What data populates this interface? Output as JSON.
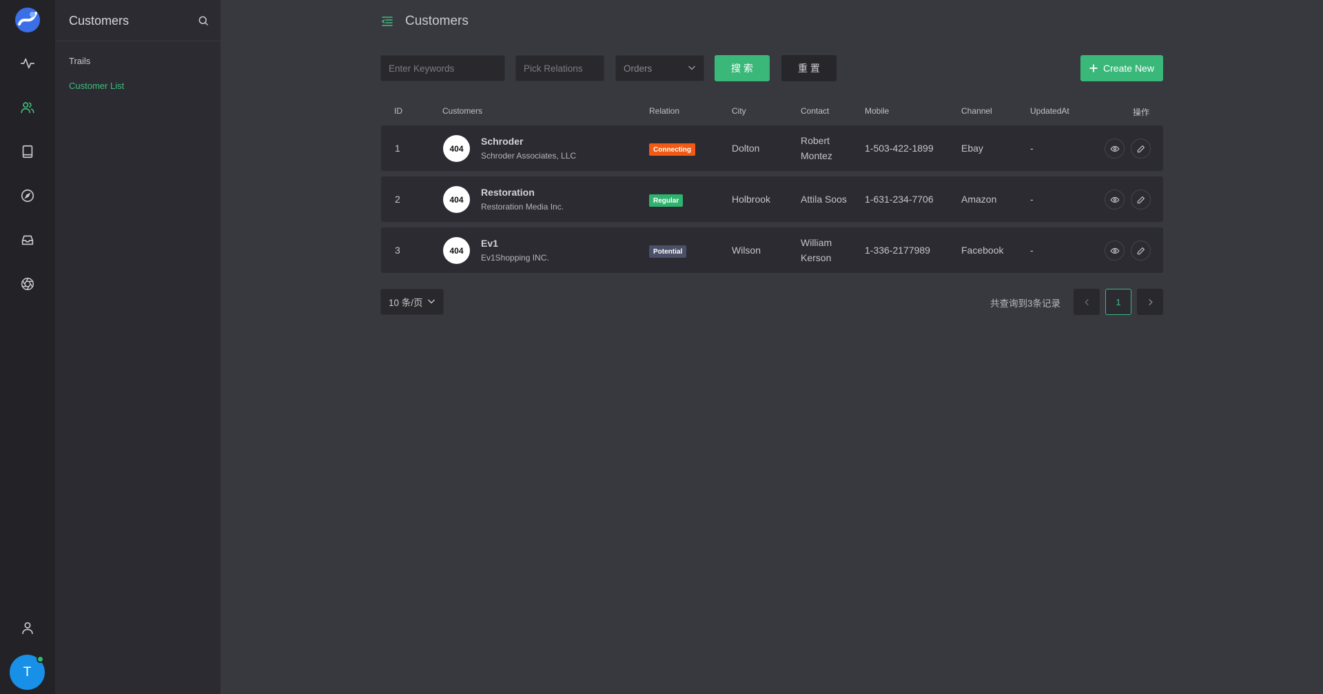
{
  "sidebar": {
    "title": "Customers",
    "items": [
      {
        "label": "Trails",
        "active": false
      },
      {
        "label": "Customer List",
        "active": true
      }
    ]
  },
  "user": {
    "initial": "T"
  },
  "page": {
    "title": "Customers"
  },
  "filters": {
    "keywords_placeholder": "Enter Keywords",
    "relations_placeholder": "Pick Relations",
    "orders_placeholder": "Orders",
    "search_label": "搜 索",
    "reset_label": "重 置",
    "create_label": "Create New"
  },
  "table": {
    "headers": [
      "ID",
      "Customers",
      "Relation",
      "City",
      "Contact",
      "Mobile",
      "Channel",
      "UpdatedAt",
      "操作"
    ],
    "rows": [
      {
        "id": "1",
        "avatar": "404",
        "name": "Schroder",
        "company": "Schroder Associates, LLC",
        "relation": "Connecting",
        "relation_color": "#f05a14",
        "city": "Dolton",
        "contact_line1": "Robert",
        "contact_line2": "Montez",
        "mobile": "1-503-422-1899",
        "channel": "Ebay",
        "updated": "-"
      },
      {
        "id": "2",
        "avatar": "404",
        "name": "Restoration",
        "company": "Restoration Media Inc.",
        "relation": "Regular",
        "relation_color": "#2fb36e",
        "city": "Holbrook",
        "contact_line1": "Attila Soos",
        "contact_line2": "",
        "mobile": "1-631-234-7706",
        "channel": "Amazon",
        "updated": "-"
      },
      {
        "id": "3",
        "avatar": "404",
        "name": "Ev1",
        "company": "Ev1Shopping INC.",
        "relation": "Potential",
        "relation_color": "#4a5068",
        "city": "Wilson",
        "contact_line1": "William",
        "contact_line2": "Kerson",
        "mobile": "1-336-2177989",
        "channel": "Facebook",
        "updated": "-"
      }
    ]
  },
  "pagination": {
    "page_size": "10 条/页",
    "total_text": "共查询到3条记录",
    "current_page": "1"
  },
  "colors": {
    "accent": "#3ab87a",
    "background": "#38383f"
  }
}
